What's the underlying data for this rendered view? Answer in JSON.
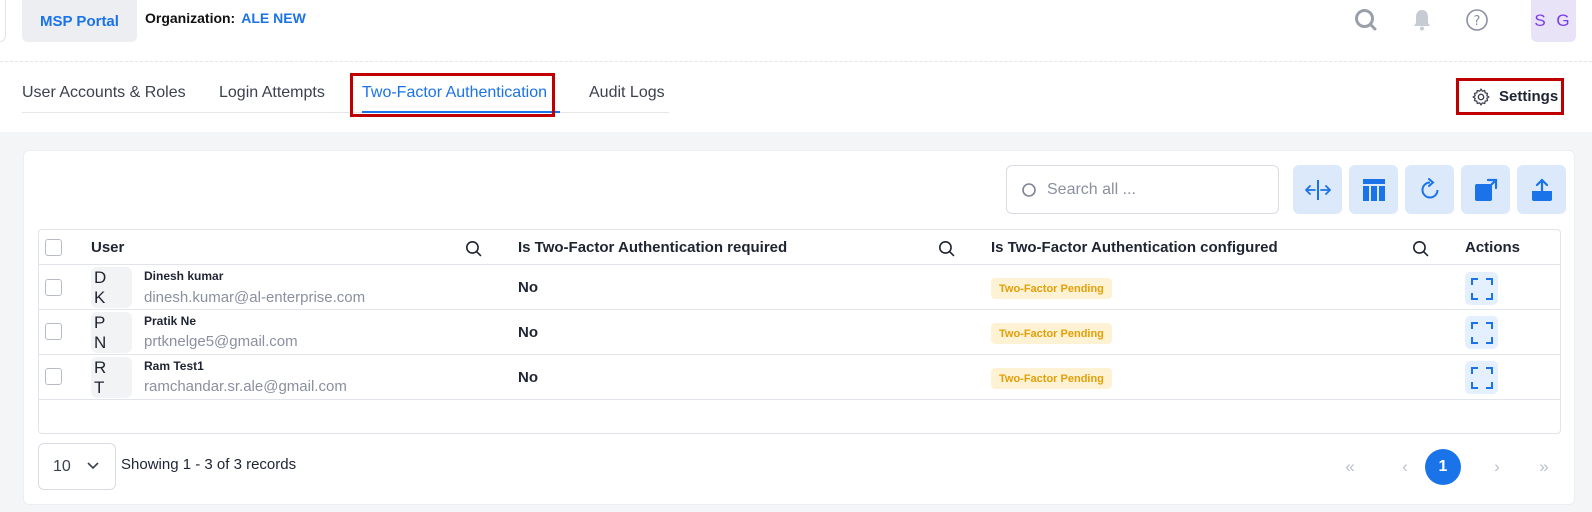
{
  "header": {
    "portal_button": "MSP Portal",
    "org_label": "Organization:",
    "org_value": "ALE NEW",
    "avatar_initials": "S G"
  },
  "tabs": [
    {
      "label": "User Accounts & Roles",
      "active": false
    },
    {
      "label": "Login Attempts",
      "active": false
    },
    {
      "label": "Two-Factor Authentication",
      "active": true
    },
    {
      "label": "Audit Logs",
      "active": false
    }
  ],
  "settings_label": "Settings",
  "search": {
    "placeholder": "Search all ..."
  },
  "table": {
    "headers": {
      "user": "User",
      "required": "Is Two-Factor Authentication required",
      "configured": "Is Two-Factor Authentication configured",
      "actions": "Actions"
    },
    "rows": [
      {
        "initials": "D K",
        "name": "Dinesh kumar",
        "email": "dinesh.kumar@al-enterprise.com",
        "required": "No",
        "status": "Two-Factor Pending"
      },
      {
        "initials": "P N",
        "name": "Pratik Ne",
        "email": "prtknelge5@gmail.com",
        "required": "No",
        "status": "Two-Factor Pending"
      },
      {
        "initials": "R T",
        "name": "Ram Test1",
        "email": "ramchandar.sr.ale@gmail.com",
        "required": "No",
        "status": "Two-Factor Pending"
      }
    ]
  },
  "pagination": {
    "page_size": "10",
    "showing": "Showing 1 - 3 of 3 records",
    "current_page": "1",
    "first": "«",
    "prev": "‹",
    "next": "›",
    "last": "»"
  },
  "colors": {
    "accent": "#1a73e8",
    "highlight": "#c00000",
    "badge_bg": "#fdf2d3",
    "badge_text": "#e3a008"
  },
  "icons": [
    "search-icon",
    "bell-icon",
    "help-icon",
    "gear-icon",
    "column-resize-icon",
    "columns-icon",
    "refresh-icon",
    "external-link-icon",
    "upload-icon",
    "expand-icon",
    "chevron-down-icon"
  ]
}
